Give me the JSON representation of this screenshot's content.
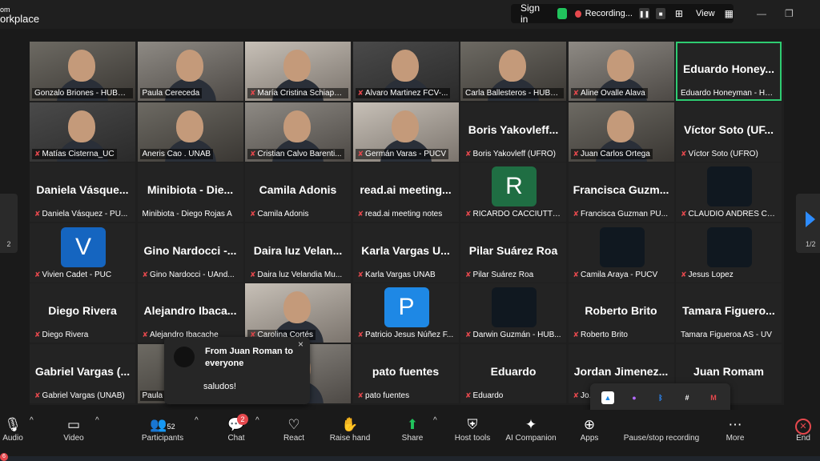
{
  "app": {
    "title_line1": "om",
    "title_line2": "orkplace"
  },
  "topbar": {
    "signin": "Sign in",
    "recording": "Recording...",
    "view": "View"
  },
  "tiles": [
    {
      "label": "Gonzalo Briones - HUBTEC",
      "video": true,
      "muted": false
    },
    {
      "label": "Paula Cereceda",
      "video": true,
      "muted": false
    },
    {
      "label": "María Cristina Schiappa...",
      "video": true,
      "muted": true
    },
    {
      "label": "Alvaro Martinez FCV-...",
      "video": true,
      "muted": true
    },
    {
      "label": "Carla Ballesteros - HUBTEC",
      "video": true,
      "muted": false
    },
    {
      "label": "Aline Ovalle Alava",
      "video": true,
      "muted": true
    },
    {
      "label": "Eduardo Honeyman - HU...",
      "big": "Eduardo  Honey...",
      "muted": false,
      "active": true
    },
    {
      "label": "Matías Cisterna_UC",
      "video": true,
      "muted": true
    },
    {
      "label": "Aneris Cao . UNAB",
      "video": true,
      "muted": false
    },
    {
      "label": "Cristian Calvo Barenti...",
      "video": true,
      "muted": true
    },
    {
      "label": "Germán Varas - PUCV",
      "video": true,
      "muted": true
    },
    {
      "label": "Boris Yakovleff (UFRO)",
      "big": "Boris  Yakovleff...",
      "muted": true
    },
    {
      "label": "Juan Carlos Ortega",
      "video": true,
      "muted": true
    },
    {
      "label": "Víctor Soto (UFRO)",
      "big": "Víctor  Soto  (UF...",
      "muted": true
    },
    {
      "label": "Daniela Vásquez - PU...",
      "big": "Daniela  Vásque...",
      "muted": true
    },
    {
      "label": "Minibiota - Diego Rojas A",
      "big": "Minibiota - Die...",
      "muted": false
    },
    {
      "label": "Camila Adonis",
      "big": "Camila  Adonis",
      "muted": true
    },
    {
      "label": "read.ai meeting notes",
      "big": "read.ai  meeting...",
      "muted": true
    },
    {
      "label": "RICARDO CACCIUTTOLO",
      "avatar": "R",
      "avatar_color": "#1f6e43",
      "muted": true
    },
    {
      "label": "Francisca Guzman PU...",
      "big": "Francisca  Guzm...",
      "muted": true
    },
    {
      "label": "CLAUDIO ANDRES CO...",
      "avatar_pic": true,
      "muted": true
    },
    {
      "label": "Vivien Cadet - PUC",
      "avatar": "V",
      "avatar_color": "#1565c0",
      "muted": true
    },
    {
      "label": "Gino Nardocci - UAnd...",
      "big": "Gino  Nardocci  -...",
      "muted": true
    },
    {
      "label": "Daira luz Velandia Mu...",
      "big": "Daira  luz  Velan...",
      "muted": true
    },
    {
      "label": "Karla Vargas UNAB",
      "big": "Karla  Vargas  U...",
      "muted": true
    },
    {
      "label": "Pilar Suárez Roa",
      "big": "Pilar  Suárez  Roa",
      "muted": true
    },
    {
      "label": "Camila Araya - PUCV",
      "avatar_pic": true,
      "muted": true
    },
    {
      "label": "Jesus Lopez",
      "avatar_pic": true,
      "muted": true
    },
    {
      "label": "Diego Rivera",
      "big": "Diego  Rivera",
      "muted": true
    },
    {
      "label": "Alejandro Ibacache",
      "big": "Alejandro  Ibaca...",
      "muted": true
    },
    {
      "label": "Carolina Cortés",
      "video": true,
      "muted": true
    },
    {
      "label": "Patricio Jesus Núñez F...",
      "avatar": "P",
      "avatar_color": "#1e88e5",
      "muted": true
    },
    {
      "label": "Darwin Guzmán - HUB...",
      "avatar_pic": true,
      "muted": true
    },
    {
      "label": "Roberto Brito",
      "big": "Roberto  Brito",
      "muted": true
    },
    {
      "label": "Tamara Figueroa AS - UV",
      "big": "Tamara  Figuero...",
      "muted": false
    },
    {
      "label": "Gabriel Vargas (UNAB)",
      "big": "Gabriel  Vargas  (...",
      "muted": true
    },
    {
      "label": "Paula",
      "video": true,
      "muted": false
    },
    {
      "label": "...zo",
      "video": true,
      "muted": false
    },
    {
      "label": "pato fuentes",
      "big": "pato  fuentes",
      "muted": true
    },
    {
      "label": "Eduardo",
      "big": "Eduardo",
      "muted": true
    },
    {
      "label": "Jo...",
      "big": "Jordan  Jimenez...",
      "muted": true
    },
    {
      "label": "...am",
      "big": "Juan  Romam",
      "muted": false
    }
  ],
  "toast": {
    "title": "From Juan Roman to everyone",
    "message": "saludos!",
    "close": "×"
  },
  "paging": {
    "prev": "2",
    "next": "1/2"
  },
  "toolbar": {
    "audio": "Audio",
    "video": "Video",
    "participants": "Participants",
    "participants_count": "52",
    "chat": "Chat",
    "chat_badge": "2",
    "react": "React",
    "raise_hand": "Raise hand",
    "share": "Share",
    "host_tools": "Host tools",
    "ai_companion": "AI Companion",
    "apps": "Apps",
    "pause_recording": "Pause/stop recording",
    "more": "More",
    "end": "End"
  },
  "taskbar": {
    "badge": "6"
  }
}
